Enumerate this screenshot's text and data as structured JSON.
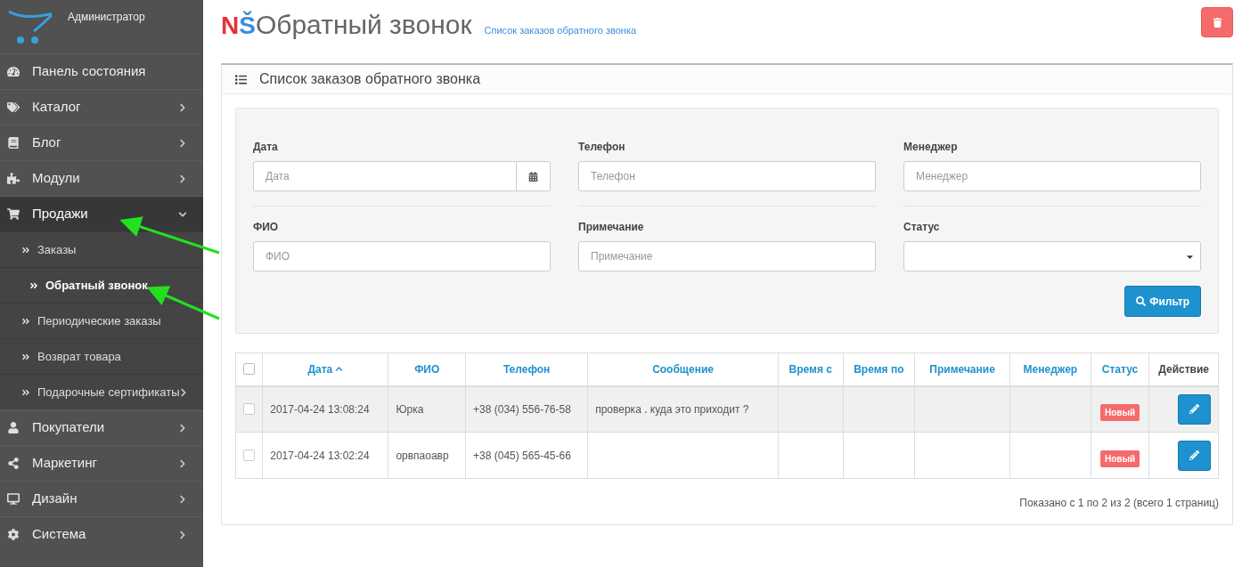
{
  "sidebar": {
    "user": "Администратор",
    "items": [
      {
        "label": "Панель состояния",
        "expandable": false,
        "expanded": false
      },
      {
        "label": "Каталог",
        "expandable": true,
        "expanded": false
      },
      {
        "label": "Блог",
        "expandable": true,
        "expanded": false
      },
      {
        "label": "Модули",
        "expandable": true,
        "expanded": false
      },
      {
        "label": "Продажи",
        "expandable": true,
        "expanded": true,
        "children": [
          {
            "label": "Заказы",
            "selected": false,
            "expandable": false
          },
          {
            "label": "Обратный звонок",
            "selected": true,
            "expandable": false
          },
          {
            "label": "Периодические заказы",
            "selected": false,
            "expandable": false
          },
          {
            "label": "Возврат товара",
            "selected": false,
            "expandable": false
          },
          {
            "label": "Подарочные сертификаты",
            "selected": false,
            "expandable": true
          }
        ]
      },
      {
        "label": "Покупатели",
        "expandable": true,
        "expanded": false
      },
      {
        "label": "Маркетинг",
        "expandable": true,
        "expanded": false
      },
      {
        "label": "Дизайн",
        "expandable": true,
        "expanded": false
      },
      {
        "label": "Система",
        "expandable": true,
        "expanded": false
      }
    ]
  },
  "header": {
    "brand": [
      "N",
      "Š"
    ],
    "title": "Обратный звонок",
    "breadcrumb": "Список заказов обратного звонка"
  },
  "panel": {
    "title": "Список заказов обратного звонка",
    "filters": [
      {
        "label": "Дата",
        "placeholder": "Дата",
        "kind": "date"
      },
      {
        "label": "Телефон",
        "placeholder": "Телефон",
        "kind": "text"
      },
      {
        "label": "Менеджер",
        "placeholder": "Менеджер",
        "kind": "text"
      },
      {
        "label": "ФИО",
        "placeholder": "ФИО",
        "kind": "text"
      },
      {
        "label": "Примечание",
        "placeholder": "Примечание",
        "kind": "text"
      },
      {
        "label": "Статус",
        "kind": "select"
      }
    ],
    "filter_button": "Фильтр",
    "table": {
      "columns": [
        {
          "label": "Дата",
          "sortable": true,
          "sorted": true
        },
        {
          "label": "ФИО",
          "sortable": true,
          "sorted": false
        },
        {
          "label": "Телефон",
          "sortable": true,
          "sorted": false
        },
        {
          "label": "Сообщение",
          "sortable": true,
          "sorted": false
        },
        {
          "label": "Время с",
          "sortable": true,
          "sorted": false
        },
        {
          "label": "Время по",
          "sortable": true,
          "sorted": false
        },
        {
          "label": "Примечание",
          "sortable": true,
          "sorted": false
        },
        {
          "label": "Менеджер",
          "sortable": true,
          "sorted": false
        },
        {
          "label": "Статус",
          "sortable": true,
          "sorted": false
        },
        {
          "label": "Действие",
          "sortable": false,
          "sorted": false
        }
      ],
      "select_all_checked": false,
      "rows": [
        {
          "checked": false,
          "highlighted": true,
          "cells": [
            "2017-04-24 13:08:24",
            "Юрка",
            "+38 (034) 556-76-58",
            "проверка . куда это приходит ?",
            "",
            "",
            "",
            ""
          ],
          "status": "Новый"
        },
        {
          "checked": false,
          "highlighted": false,
          "cells": [
            "2017-04-24 13:02:24",
            "орвпаоавр",
            "+38 (045) 565-45-66",
            "",
            "",
            "",
            "",
            ""
          ],
          "status": "Новый"
        }
      ]
    },
    "pagination": "Показано с 1 по 2 из 2 (всего 1 страниц)"
  }
}
